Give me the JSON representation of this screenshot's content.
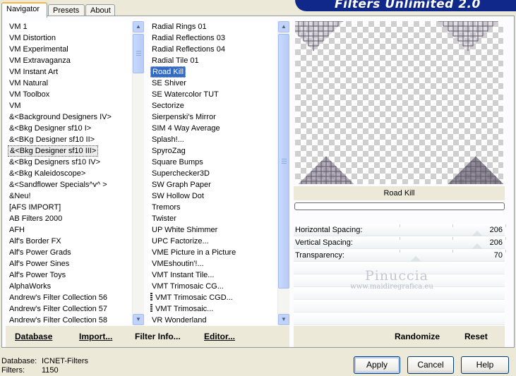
{
  "tabs": [
    {
      "label": "Navigator"
    },
    {
      "label": "Presets"
    },
    {
      "label": "About"
    }
  ],
  "banner": {
    "title": "Filters Unlimited 2.0"
  },
  "categories": [
    "VM 1",
    "VM Distortion",
    "VM Experimental",
    "VM Extravaganza",
    "VM Instant Art",
    "VM Natural",
    "VM Toolbox",
    "VM",
    "&<Background Designers IV>",
    "&<Bkg Designer sf10 I>",
    "&<BKg Designer sf10 II>",
    "&<Bkg Designer sf10 III>",
    "&<Bkg Designers sf10 IV>",
    "&<Bkg Kaleidoscope>",
    "&<Sandflower Specials^v^ >",
    "&Neu!",
    "[AFS IMPORT]",
    "AB Filters 2000",
    "AFH",
    "Alf's Border FX",
    "Alf's Power Grads",
    "Alf's Power Sines",
    "Alf's Power Toys",
    "AlphaWorks",
    "Andrew's Filter Collection 56",
    "Andrew's Filter Collection 57",
    "Andrew's Filter Collection 58"
  ],
  "selected_category": "&<Bkg Designer sf10 III>",
  "filters": [
    "Radial  Rings 01",
    "Radial Reflections 03",
    "Radial Reflections 04",
    "Radial Tile 01",
    "Road Kill",
    "SE Shiver",
    "SE Watercolor TUT",
    "Sectorize",
    "Sierpenski's Mirror",
    "SIM 4 Way Average",
    "Splash!...",
    "SpyroZag",
    "Square Bumps",
    "Superchecker3D",
    "SW Graph Paper",
    "SW Hollow Dot",
    "Tremors",
    "Twister",
    "UP White Shimmer",
    "UPC Factorize...",
    "VME Picture in a Picture",
    "VMEshoutin'!...",
    "VMT Instant Tile...",
    "VMT Trimosaic CG...",
    "VMT Trimosaic CGD...",
    "VMT Trimosaic...",
    "VR Wonderland"
  ],
  "selected_filter": "Road Kill",
  "current_filter_name": "Road Kill",
  "params": [
    {
      "label": "Horizontal Spacing:",
      "value": "206",
      "fraction": 0.81
    },
    {
      "label": "Vertical Spacing:",
      "value": "206",
      "fraction": 0.81
    },
    {
      "label": "Transparency:",
      "value": "70",
      "fraction": 0.27
    }
  ],
  "watermark": {
    "name": "Pinuccia",
    "site": "www.maidiregrafica.eu"
  },
  "bottom_bar": {
    "database": "Database",
    "import": "Import...",
    "filter_info": "Filter Info...",
    "editor": "Editor...",
    "randomize": "Randomize",
    "reset": "Reset"
  },
  "status": {
    "database_label": "Database:",
    "database_value": "ICNET-Filters",
    "filters_label": "Filters:",
    "filters_value": "1150"
  },
  "buttons": {
    "apply": "Apply",
    "cancel": "Cancel",
    "help": "Help"
  },
  "colors": {
    "banner": "#10288a",
    "selection": "#316ac5",
    "tab_active_border": "#f7b542"
  }
}
